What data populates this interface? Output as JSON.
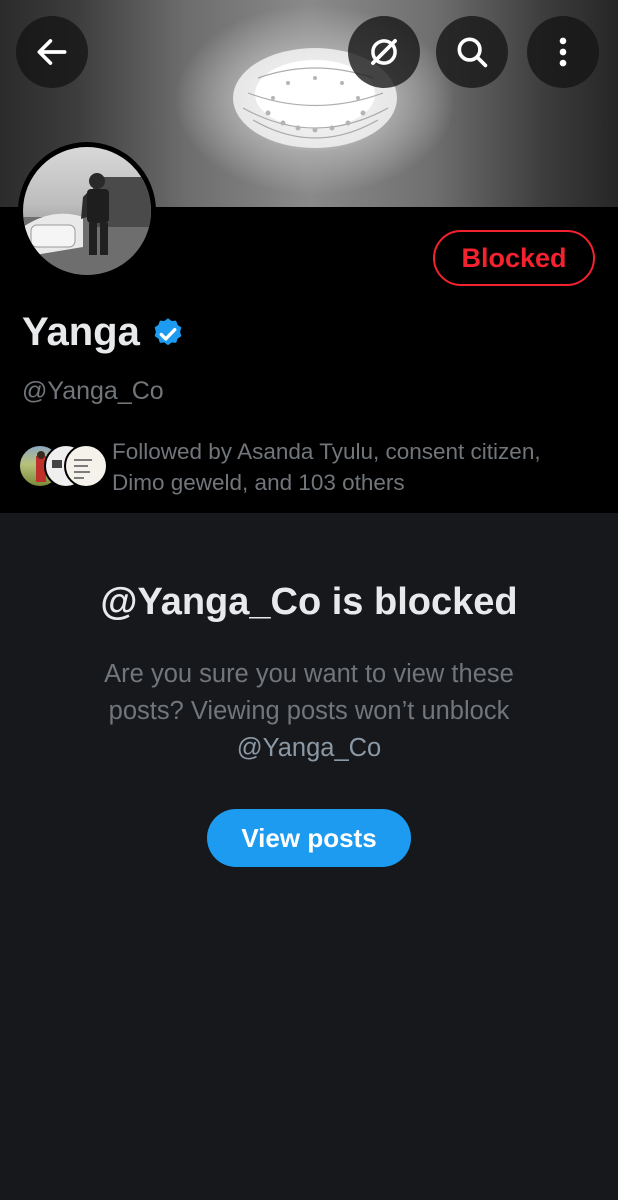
{
  "header": {
    "back_icon": "arrow-left-icon",
    "grok_icon": "grok-icon",
    "search_icon": "search-icon",
    "more_icon": "more-vertical-icon"
  },
  "profile": {
    "display_name": "Yanga",
    "handle": "@Yanga_Co",
    "verified": true,
    "blocked_label": "Blocked",
    "followed_by": "Followed by Asanda Tyulu, consent citizen, Dimo geweld, and 103 others"
  },
  "blocked_notice": {
    "title": "@Yanga_Co is blocked",
    "message_line1": "Are you sure you want to view these",
    "message_line2": "posts? Viewing posts won’t unblock",
    "message_handle": "@Yanga_Co",
    "view_posts_label": "View posts"
  },
  "colors": {
    "accent": "#1d9bf0",
    "blocked_red": "#f4212e",
    "background": "#16181c",
    "text_primary": "#e7e9ea",
    "text_secondary": "#71767b"
  }
}
